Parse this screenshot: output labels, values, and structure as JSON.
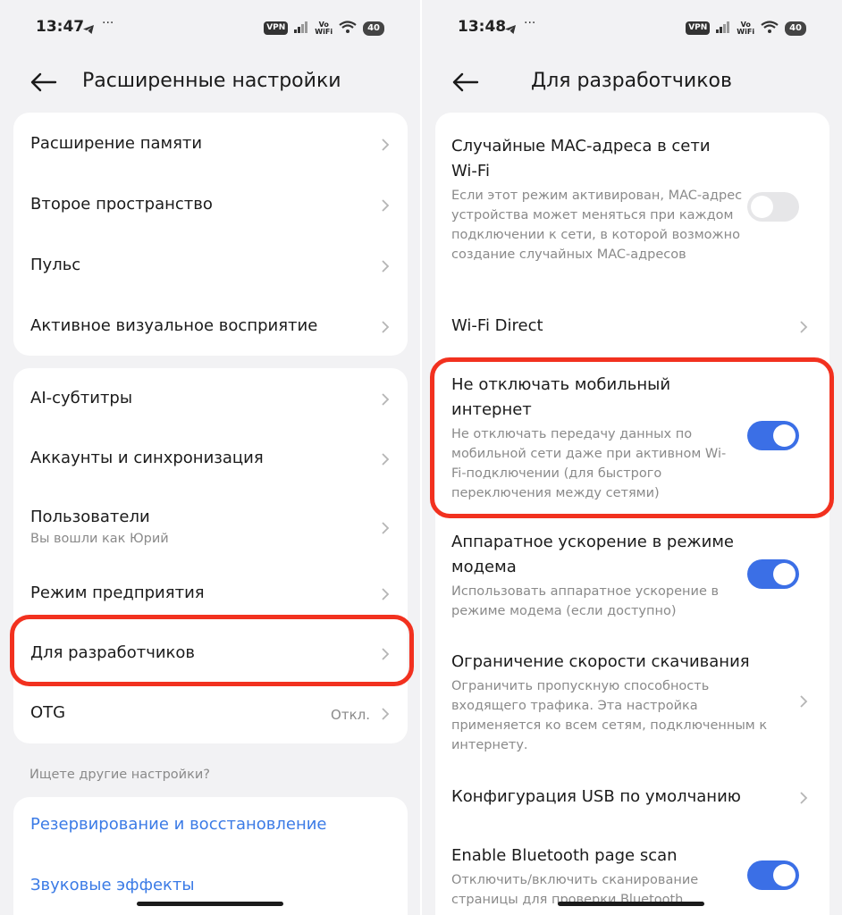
{
  "left": {
    "status": {
      "time": "13:47",
      "vpn": "VPN",
      "volte_top": "Vo",
      "volte_bottom": "WiFi",
      "battery": "40"
    },
    "title": "Расширенные настройки",
    "group1": [
      "Расширение памяти",
      "Второе пространство",
      "Пульс",
      "Активное визуальное восприятие"
    ],
    "group2": {
      "ai": "AI-субтитры",
      "accounts": "Аккаунты и синхронизация",
      "users": "Пользователи",
      "users_sub": "Вы вошли как Юрий",
      "enterprise": "Режим предприятия",
      "developers": "Для разработчиков",
      "otg": "OTG",
      "otg_value": "Откл."
    },
    "hint": "Ищете другие настройки?",
    "links": [
      "Резервирование и восстановление",
      "Звуковые эффекты"
    ]
  },
  "right": {
    "status": {
      "time": "13:48",
      "vpn": "VPN",
      "volte_top": "Vo",
      "volte_bottom": "WiFi",
      "battery": "40"
    },
    "title": "Для разработчиков",
    "items": {
      "mac_title": "Случайные MAC-адреса в сети Wi-Fi",
      "mac_desc": "Если этот режим активирован, MAC-адрес устройства может меняться при каждом подключении к сети, в которой возможно создание случайных MAC-адресов",
      "mac_on": false,
      "wifi_direct": "Wi-Fi Direct",
      "mobile_title": "Не отключать мобильный интернет",
      "mobile_desc": "Не отключать передачу данных по мобильной сети даже при активном Wi-Fi-подключении (для быстрого переключения между сетями)",
      "mobile_on": true,
      "hw_title": "Аппаратное ускорение в режиме модема",
      "hw_desc": "Использовать аппаратное ускорение в режиме модема (если доступно)",
      "hw_on": true,
      "limit_title": "Ограничение скорости скачивания",
      "limit_desc": "Ограничить пропускную способность входящего трафика. Эта настройка применяется ко всем сетям, подключенным к интернету.",
      "usb": "Конфигурация USB по умолчанию",
      "bt_title": "Enable Bluetooth page scan",
      "bt_desc": "Отключить/включить сканирование страницы для проверки Bluetooth",
      "bt_on": true
    }
  },
  "colors": {
    "accent": "#3b6fe6",
    "link": "#3b7be6",
    "highlight": "#f2311f",
    "background": "#f2f2f4",
    "card": "#ffffff"
  }
}
